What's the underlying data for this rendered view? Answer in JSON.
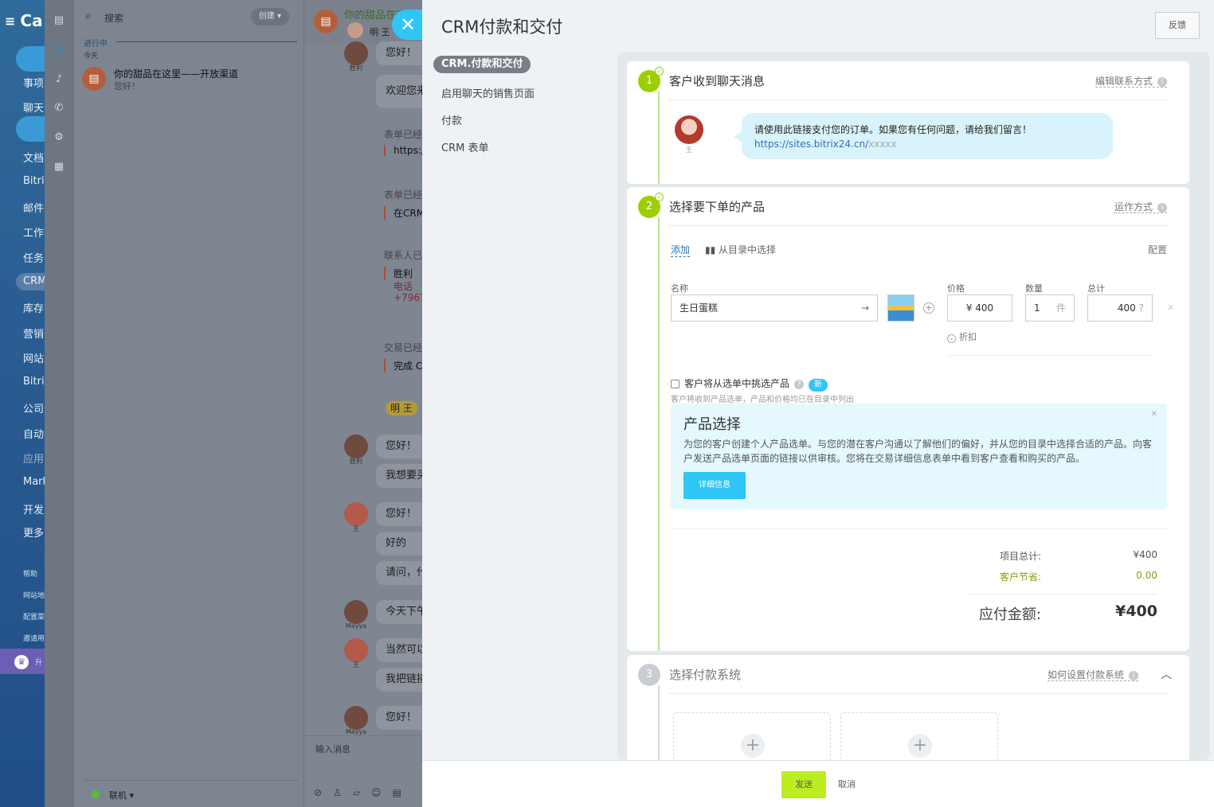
{
  "app": {
    "logo": "Ca",
    "menu": [
      "事项",
      "聊天",
      "文档",
      "Bitri",
      "邮件",
      "工作",
      "任务",
      "CRM",
      "库存",
      "营销",
      "网站",
      "Bitri",
      "公司",
      "自动",
      "应用",
      "Mark",
      "开发",
      "更多"
    ],
    "menu_small": [
      "帮助",
      "网站地",
      "配置菜",
      "邀请用"
    ],
    "upgrade": "升"
  },
  "chat_list": {
    "search_placeholder": "搜索",
    "create_label": "创建",
    "section": "进行中",
    "today": "今天",
    "item_title": "你的甜品在这里——开放渠道",
    "item_sub": "您好！",
    "status": "联机"
  },
  "chat": {
    "title": "你的甜品在这里",
    "subtitle": "明 王",
    "messages": [
      {
        "text": "您好！"
      },
      {
        "text": "欢迎您来"
      },
      {
        "text": "您好！"
      },
      {
        "text": "我想要买"
      },
      {
        "text": "您好！"
      },
      {
        "text": "好的"
      },
      {
        "text": "请问，什"
      },
      {
        "text": "今天下午"
      },
      {
        "text": "当然可以"
      },
      {
        "text": "我把链接"
      },
      {
        "text": "您好！"
      }
    ],
    "sender_names": [
      "胜利",
      "胜利",
      "王",
      "Mayya",
      "王",
      "Mayya"
    ],
    "sys1_label": "表单已经",
    "sys1_value": "https:/",
    "sys2_label": "表单已经",
    "sys2_value": "在CRM",
    "sys3_label": "联系人已",
    "sys3_name": "胜利",
    "sys3_phone_label": "电话",
    "sys3_phone": "+7967",
    "sys4_label": "交易已经",
    "sys4_value": "完成 C",
    "name_badge": "明 王",
    "input_placeholder": "输入消息"
  },
  "panel": {
    "title": "CRM付款和交付",
    "feedback": "反馈",
    "nav": [
      "CRM.付款和交付",
      "启用聊天的销售页面",
      "付款",
      "CRM 表单"
    ],
    "stage1": {
      "num": "1",
      "title": "客户收到聊天消息",
      "link": "编辑联系方式",
      "customer_name": "王",
      "message": "请使用此链接支付您的订单。如果您有任何问题，请给我们留言！",
      "url": "https://sites.bitrix24.cn/",
      "url_suffix": "xxxxx"
    },
    "stage2": {
      "num": "2",
      "title": "选择要下单的产品",
      "link": "运作方式",
      "add": "添加",
      "catalog": "从目录中选择",
      "config": "配置",
      "name_label": "名称",
      "name_value": "生日蛋糕",
      "price_label": "价格",
      "price_value": "¥ 400",
      "qty_label": "数量",
      "qty_value": "1",
      "qty_unit": "件",
      "total_label": "总计",
      "total_value": "400",
      "discount": "折扣",
      "checkbox_label": "客户将从选单中挑选产品",
      "new_badge": "新",
      "hint": "客户将收到产品选单，产品和价格均已在目录中列出",
      "info_title": "产品选择",
      "info_desc": "为您的客户创建个人产品选单。与您的潜在客户沟通以了解他们的偏好，并从您的目录中选择合适的产品。向客户发送产品选单页面的链接以供审核。您将在交易详细信息表单中看到客户查看和购买的产品。",
      "info_button": "详细信息",
      "items_total_label": "项目总计:",
      "items_total_value": "¥400",
      "savings_label": "客户节省:",
      "savings_value": "0.00",
      "due_label": "应付金额:",
      "due_value": "¥400"
    },
    "stage3": {
      "num": "3",
      "title": "选择付款系统",
      "link": "如何设置付款系统"
    },
    "footer": {
      "send": "发送",
      "cancel": "取消"
    }
  }
}
